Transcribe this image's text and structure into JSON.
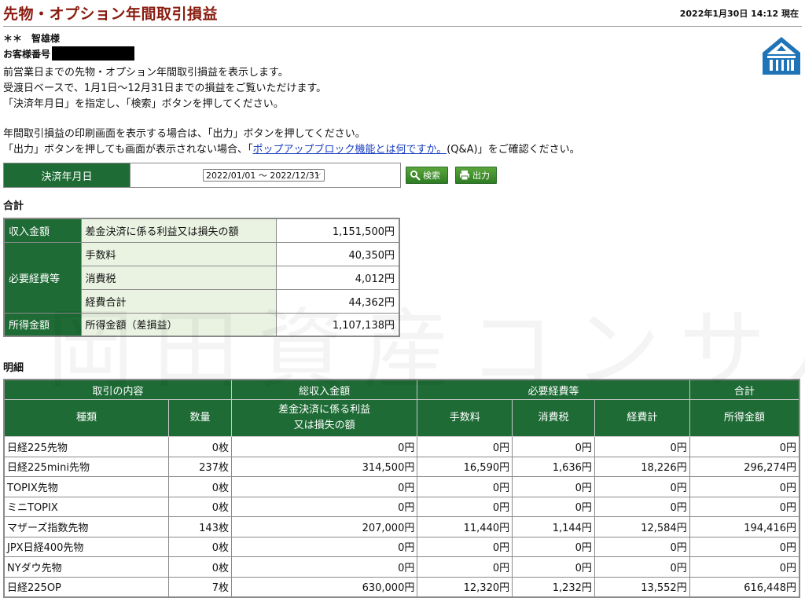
{
  "header": {
    "title": "先物・オプション年間取引損益",
    "timestamp": "2022年1月30日 14:12 現在"
  },
  "customer": {
    "name": "＊＊　智雄様",
    "number_label": "お客様番号"
  },
  "intro_lines": [
    "前営業日までの先物・オプション年間取引損益を表示します。",
    "受渡日ベースで、1月1日〜12月31日までの損益をご覧いただけます。",
    "「決済年月日」を指定し、「検索」ボタンを押してください。"
  ],
  "notes": {
    "line1": "年間取引損益の印刷画面を表示する場合は、「出力」ボタンを押してください。",
    "line2_prefix": "「出力」ボタンを押しても画面が表示されない場合、「",
    "line2_link": "ポップアップブロック機能とは何ですか。",
    "line2_suffix": "(Q&A)」をご確認ください。"
  },
  "search": {
    "label": "決済年月日",
    "selected_period": "2022/01/01 ～ 2022/12/31",
    "search_button": "検索",
    "output_button": "出力"
  },
  "summary": {
    "title": "合計",
    "revenue_label": "収入金額",
    "revenue_sub": "差金決済に係る利益又は損失の額",
    "revenue_value": "1,151,500円",
    "expenses_label": "必要経費等",
    "commission_label": "手数料",
    "commission_value": "40,350円",
    "tax_label": "消費税",
    "tax_value": "4,012円",
    "expense_total_label": "経費合計",
    "expense_total_value": "44,362円",
    "income_label": "所得金額",
    "income_sub": "所得金額（差損益）",
    "income_value": "1,107,138円"
  },
  "detail": {
    "title": "明細",
    "group_headers": {
      "content": "取引の内容",
      "gross": "総収入金額",
      "expenses": "必要経費等",
      "total": "合計"
    },
    "col_headers": {
      "type": "種類",
      "quantity": "数量",
      "pl_line1": "差金決済に係る利益",
      "pl_line2": "又は損失の額",
      "commission": "手数料",
      "tax": "消費税",
      "expense_total": "経費計",
      "income": "所得金額"
    },
    "rows": [
      {
        "type": "日経225先物",
        "qty": "0枚",
        "pl": "0円",
        "commission": "0円",
        "tax": "0円",
        "expense": "0円",
        "income": "0円"
      },
      {
        "type": "日経225mini先物",
        "qty": "237枚",
        "pl": "314,500円",
        "commission": "16,590円",
        "tax": "1,636円",
        "expense": "18,226円",
        "income": "296,274円"
      },
      {
        "type": "TOPIX先物",
        "qty": "0枚",
        "pl": "0円",
        "commission": "0円",
        "tax": "0円",
        "expense": "0円",
        "income": "0円"
      },
      {
        "type": "ミニTOPIX",
        "qty": "0枚",
        "pl": "0円",
        "commission": "0円",
        "tax": "0円",
        "expense": "0円",
        "income": "0円"
      },
      {
        "type": "マザーズ指数先物",
        "qty": "143枚",
        "pl": "207,000円",
        "commission": "11,440円",
        "tax": "1,144円",
        "expense": "12,584円",
        "income": "194,416円"
      },
      {
        "type": "JPX日経400先物",
        "qty": "0枚",
        "pl": "0円",
        "commission": "0円",
        "tax": "0円",
        "expense": "0円",
        "income": "0円"
      },
      {
        "type": "NYダウ先物",
        "qty": "0枚",
        "pl": "0円",
        "commission": "0円",
        "tax": "0円",
        "expense": "0円",
        "income": "0円"
      },
      {
        "type": "日経225OP",
        "qty": "7枚",
        "pl": "630,000円",
        "commission": "12,320円",
        "tax": "1,232円",
        "expense": "13,552円",
        "income": "616,448円"
      }
    ]
  },
  "watermark": "岡田資産コンサル",
  "colors": {
    "header_green": "#1e6b35",
    "title_red": "#8a1c10",
    "sub_cell": "#eaf3e2",
    "logo_blue": "#1f74b8"
  }
}
